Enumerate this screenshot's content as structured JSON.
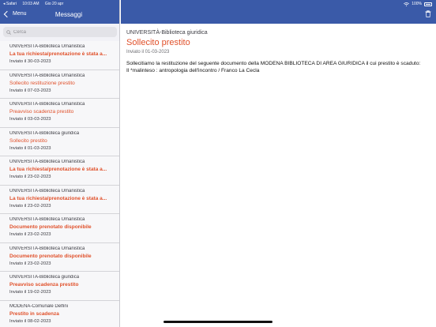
{
  "status": {
    "carrier": "◂ Safari",
    "time": "10:03 AM",
    "date": "Gio 20 apr",
    "battery": "100%"
  },
  "sidebar": {
    "back_label": "Menu",
    "title": "Messaggi",
    "search_placeholder": "Cerca",
    "items": [
      {
        "from": "UNIVERSITÀ-Biblioteca Umanistica",
        "subject": "La tua richiesta/prenotazione è stata a...",
        "date": "Inviato il 30-03-2023"
      },
      {
        "from": "UNIVERSITÀ-Biblioteca Umanistica",
        "subject": "Sollecito restituzione prestito",
        "date": "Inviato il 07-03-2023"
      },
      {
        "from": "UNIVERSITÀ-Biblioteca Umanistica",
        "subject": "Preavviso scadenza prestito",
        "date": "Inviato il 03-03-2023"
      },
      {
        "from": "UNIVERSITÀ-Biblioteca giuridica",
        "subject": "Sollecito prestito",
        "date": "Inviato il 01-03-2023"
      },
      {
        "from": "UNIVERSITÀ-Biblioteca Umanistica",
        "subject": "La tua richiesta/prenotazione è stata a...",
        "date": "Inviato il 23-02-2023"
      },
      {
        "from": "UNIVERSITÀ-Biblioteca Umanistica",
        "subject": "La tua richiesta/prenotazione è stata a...",
        "date": "Inviato il 23-02-2023"
      },
      {
        "from": "UNIVERSITÀ-Biblioteca Umanistica",
        "subject": "Documento prenotato disponibile",
        "date": "Inviato il 23-02-2023"
      },
      {
        "from": "UNIVERSITÀ-Biblioteca Umanistica",
        "subject": "Documento prenotato disponibile",
        "date": "Inviato il 23-02-2023"
      },
      {
        "from": "UNIVERSITÀ-Biblioteca giuridica",
        "subject": "Preavviso scadenza prestito",
        "date": "Inviato il 19-02-2023"
      },
      {
        "from": "MODENA-Comunale Delfini",
        "subject": "Prestito in scadenza",
        "date": "Inviato il 08-02-2023"
      }
    ]
  },
  "detail": {
    "from": "UNIVERSITÀ-Biblioteca giuridica",
    "subject": "Sollecito prestito",
    "date": "Inviato il 01-03-2023",
    "body_line1": "Sollecitiamo la restituzione del seguente documento della MODENA BIBLIOTECA DI AREA GIURIDICA il cui prestito è scaduto:",
    "body_line2": "Il *malinteso : antropologia dell'incontro / Franco La Cecla"
  },
  "colors": {
    "header": "#3a5aa8",
    "accent": "#e0502a"
  }
}
